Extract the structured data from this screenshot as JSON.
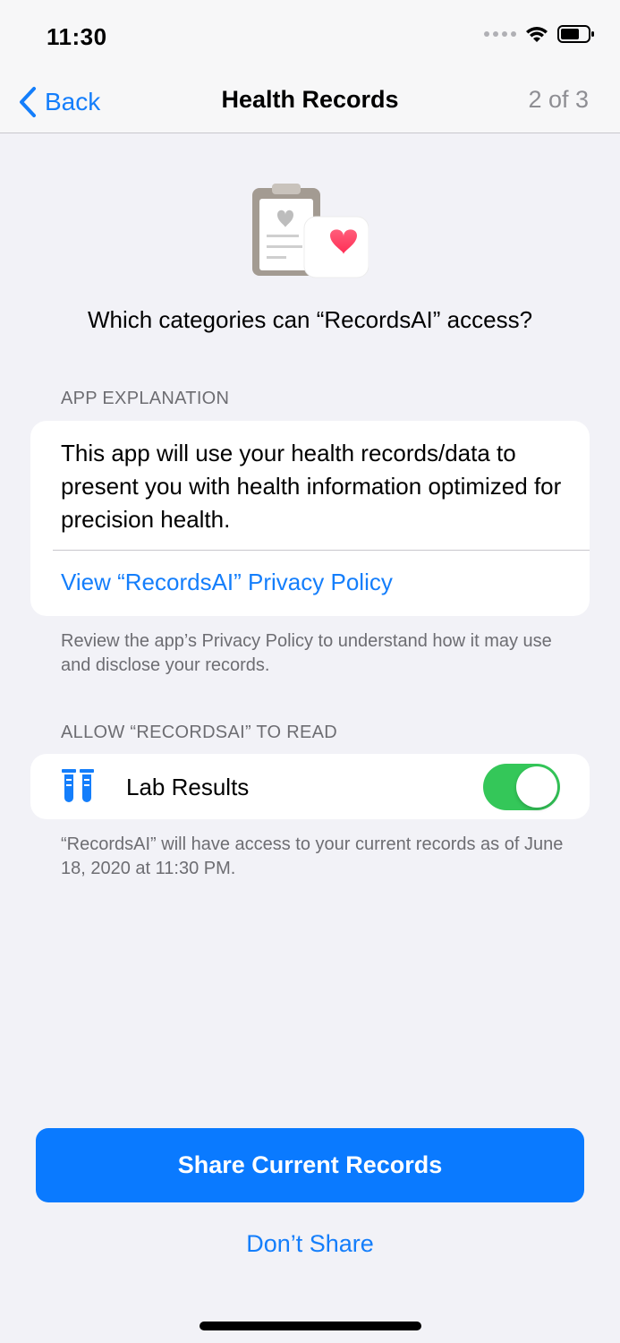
{
  "status_bar": {
    "time": "11:30"
  },
  "nav": {
    "back_label": "Back",
    "title": "Health Records",
    "step": "2 of 3"
  },
  "question": "Which categories can “RecordsAI” access?",
  "explanation_section": {
    "header": "APP EXPLANATION",
    "text": "This app will use your health records/data to present you with health information optimized for precision health.",
    "privacy_link": "View “RecordsAI” Privacy Policy",
    "footer": "Review the app’s Privacy Policy to understand how it may use and disclose your records."
  },
  "read_section": {
    "header": "ALLOW “RECORDSAI” TO READ",
    "items": [
      {
        "label": "Lab Results",
        "icon": "test-tubes-icon",
        "enabled": true
      }
    ],
    "footer": "“RecordsAI” will have access to your current records as of June 18, 2020 at 11:30 PM."
  },
  "actions": {
    "primary": "Share Current Records",
    "secondary": "Don’t Share"
  },
  "colors": {
    "accent": "#147EFB",
    "primary_button": "#0A7AFF",
    "toggle_on": "#34C759",
    "background": "#F2F2F7",
    "heart": "#FF2D55"
  }
}
